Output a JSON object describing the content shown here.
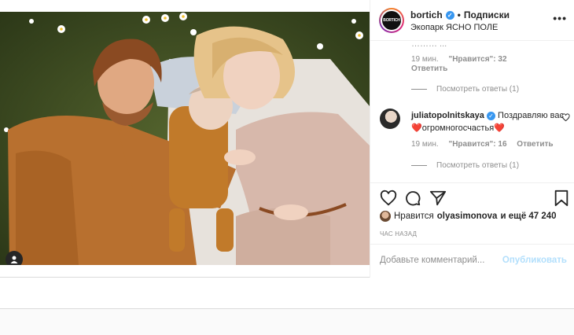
{
  "header": {
    "username": "bortich",
    "verified_mark": "✓",
    "separator": "•",
    "follow_label": "Подписки",
    "location": "Экопарк ЯСНО ПОЛЕ",
    "more_label": "•••",
    "avatar_text": "BORTICH"
  },
  "comments": [
    {
      "text_fragment": "……… ...",
      "time": "19 мин.",
      "likes": "\"Нравится\": 32",
      "reply_label": "Ответить",
      "view_replies": "Посмотреть ответы (1)"
    },
    {
      "username": "juliatopolnitskaya",
      "verified_mark": "✓",
      "text": "Поздравляю вас❤️огромногосчастья❤️",
      "time": "19 мин.",
      "likes": "\"Нравится\": 16",
      "reply_label": "Ответить",
      "view_replies": "Посмотреть ответы (1)"
    }
  ],
  "likes": {
    "prefix": "Нравится",
    "user": "olyasimonova",
    "suffix": "и ещё 47 240"
  },
  "time_ago": "ЧАС НАЗАД",
  "add_comment": {
    "placeholder": "Добавьте комментарий...",
    "publish_label": "Опубликовать"
  },
  "colors": {
    "verified": "#3897f0",
    "publish_disabled": "#b2dffc",
    "heart": "#ed4956"
  },
  "icons": [
    "heart-icon",
    "comment-icon",
    "share-icon",
    "bookmark-icon",
    "more-icon",
    "user-tag-icon"
  ]
}
